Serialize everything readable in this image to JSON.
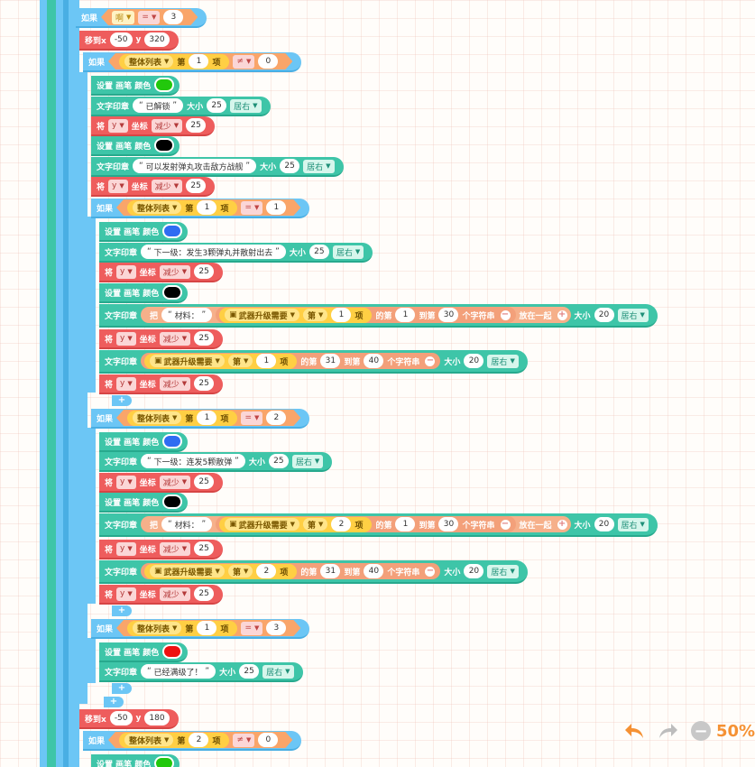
{
  "labels": {
    "if": "如果",
    "moveto": "移到x",
    "y": "y",
    "set_pen": "设置 画笔 颜色",
    "stamp": "文字印章",
    "size": "大小",
    "set_var": "将",
    "coord": "坐标",
    "list_label": "整体列表",
    "item_pre": "第",
    "item_post": "项",
    "of_char": "的第",
    "to": "到第",
    "char_suffix": "个字符串",
    "join": "放在一起",
    "join_pre": "把",
    "weapon_list": "武器升级需要",
    "plus": "+"
  },
  "dropdowns": {
    "align": "居右",
    "axis": "y",
    "decrease": "减少",
    "eq": "=",
    "neq": "≠",
    "var_a": "啊"
  },
  "colors": {
    "ctrl": "#6cc6f5",
    "pen": "#3ec5a8",
    "motion": "#ee5d5d",
    "green": "#22c80c",
    "black": "#000000",
    "blue": "#2f6cf2",
    "red": "#ee1111",
    "accent": "#f59133"
  },
  "rows": {
    "r1": {
      "value": "3"
    },
    "r2": {
      "x": "-50",
      "y": "320"
    },
    "r3": {
      "index": "1",
      "value": "0"
    },
    "r5": {
      "text": "已解锁",
      "size": "25"
    },
    "r6": {
      "value": "25"
    },
    "r8": {
      "text": "可以发射弹丸攻击敌方战舰",
      "size": "25"
    },
    "r9": {
      "value": "25"
    },
    "r10": {
      "index": "1",
      "value": "1"
    },
    "r12": {
      "text": "下一级：发生3颗弹丸并散射出去",
      "size": "25"
    },
    "r13": {
      "value": "25"
    },
    "r15": {
      "pre": "材料：",
      "index": "1",
      "from": "1",
      "to": "30",
      "size": "20"
    },
    "r16": {
      "value": "25"
    },
    "r17": {
      "index": "1",
      "from": "31",
      "to": "40",
      "size": "20"
    },
    "r18": {
      "value": "25"
    },
    "r20": {
      "index": "1",
      "value": "2"
    },
    "r22": {
      "text": "下一级：连发5颗散弹",
      "size": "25"
    },
    "r23": {
      "value": "25"
    },
    "r25": {
      "pre": "材料：",
      "index": "2",
      "from": "1",
      "to": "30",
      "size": "20"
    },
    "r26": {
      "value": "25"
    },
    "r27": {
      "index": "2",
      "from": "31",
      "to": "40",
      "size": "20"
    },
    "r28": {
      "value": "25"
    },
    "r30": {
      "index": "1",
      "value": "3"
    },
    "r32": {
      "text": "已经满级了！",
      "size": "25"
    },
    "r35": {
      "x": "-50",
      "y": "180"
    },
    "r36": {
      "index": "2",
      "value": "0"
    }
  },
  "zoom": {
    "undo_icon": "undo-icon",
    "redo_icon": "redo-icon",
    "percent": "50%"
  }
}
